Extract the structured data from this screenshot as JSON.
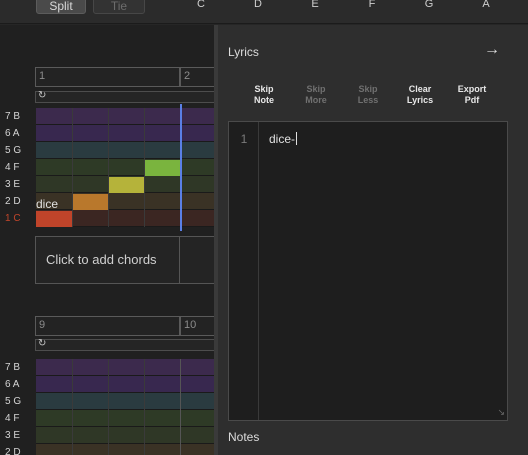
{
  "toolbar": {
    "split_label": "Split",
    "tie_label": "Tie",
    "note_columns": [
      "C",
      "D",
      "E",
      "F",
      "G",
      "A"
    ]
  },
  "sequencer": {
    "measures_top": [
      "1",
      "2"
    ],
    "measures_bottom": [
      "9",
      "10"
    ],
    "rows_top": [
      "7 B",
      "6 A",
      "5 G",
      "4 F",
      "3 E",
      "2 D",
      "1 C"
    ],
    "rows_bottom": [
      "7 B",
      "6 A",
      "5 G",
      "4 F",
      "3 E",
      "2 D"
    ],
    "lyric_word": "dice",
    "chord_placeholder": "Click to add chords",
    "loop_icon": "loop-icon",
    "colors": {
      "row_7": "#3c2a4d",
      "row_6": "#38284f",
      "row_5": "#2a3b40",
      "row_4": "#2e3a26",
      "row_3": "#2f3726",
      "row_2": "#3a3225",
      "row_1": "#3b2622",
      "note_1": "#c0442a",
      "note_2": "#b9782c",
      "note_3": "#b5b33a",
      "note_4": "#7ab43e",
      "playhead": "#5a7fe6"
    }
  },
  "lyrics_panel": {
    "title": "Lyrics",
    "arrow_icon": "arrow-right-icon",
    "tools": [
      {
        "label1": "Skip",
        "label2": "Note",
        "enabled": true
      },
      {
        "label1": "Skip",
        "label2": "More",
        "enabled": false
      },
      {
        "label1": "Skip",
        "label2": "Less",
        "enabled": false
      },
      {
        "label1": "Clear",
        "label2": "Lyrics",
        "enabled": true
      },
      {
        "label1": "Export",
        "label2": "Pdf",
        "enabled": true
      }
    ],
    "editor": {
      "line_number": "1",
      "text": "dice-"
    },
    "notes_label": "Notes"
  }
}
